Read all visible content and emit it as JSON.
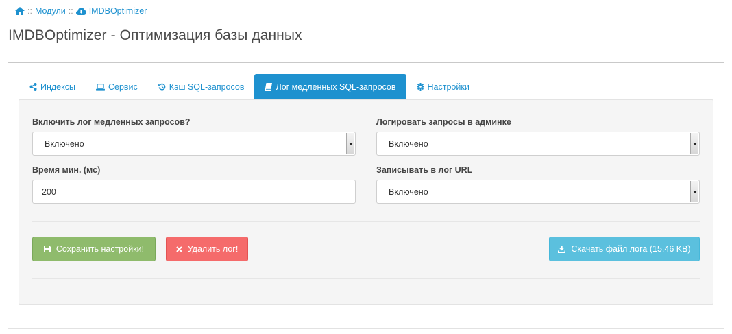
{
  "breadcrumb": {
    "home_icon": "home-icon",
    "separator": "::",
    "modules_label": "Модули",
    "module_icon": "cloud-download-icon",
    "module_label": "IMDBOptimizer"
  },
  "page_title": "IMDBOptimizer - Оптимизация базы данных",
  "tabs": [
    {
      "label": "Индексы",
      "icon": "share-alt-icon",
      "active": false
    },
    {
      "label": "Сервис",
      "icon": "laptop-icon",
      "active": false
    },
    {
      "label": "Кэш SQL-запросов",
      "icon": "history-icon",
      "active": false
    },
    {
      "label": "Лог медленных SQL-запросов",
      "icon": "book-icon",
      "active": true
    },
    {
      "label": "Настройки",
      "icon": "cog-icon",
      "active": false
    }
  ],
  "form": {
    "enable_log": {
      "label": "Включить лог медленных запросов?",
      "value": "Включено"
    },
    "log_admin": {
      "label": "Логировать запросы в админке",
      "value": "Включено"
    },
    "min_time": {
      "label": "Время мин. (мс)",
      "value": "200"
    },
    "log_url": {
      "label": "Записывать в лог URL",
      "value": "Включено"
    }
  },
  "buttons": {
    "save": {
      "label": "Сохранить настройки!",
      "icon": "save-icon"
    },
    "delete": {
      "label": "Удалить лог!",
      "icon": "close-icon"
    },
    "download": {
      "label": "Скачать файл лога (15.46 KB)",
      "icon": "download-icon"
    }
  },
  "colors": {
    "accent": "#1e91cf",
    "success": "#8fbb6c",
    "danger": "#f56b6b",
    "info": "#5bc0de"
  }
}
